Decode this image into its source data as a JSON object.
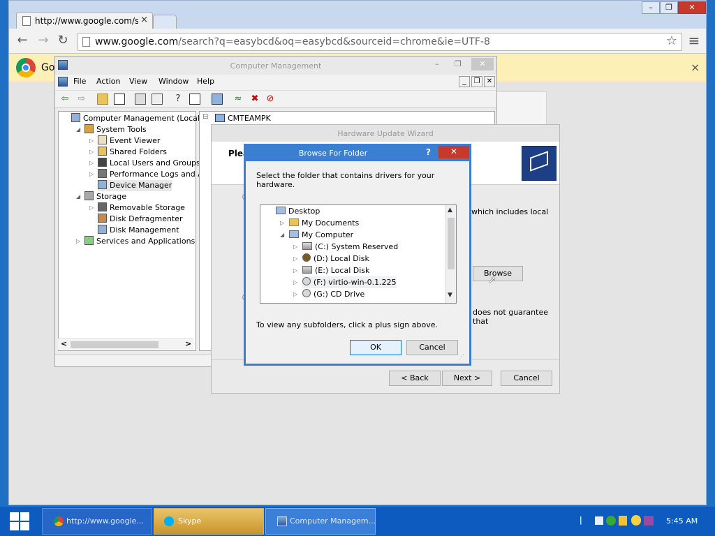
{
  "chrome": {
    "tab_title": "http://www.google.com/sear",
    "tab_close": "×",
    "url_domain": "www.google.com",
    "url_path": "/search?q=easybcd&oq=easybcd&sourceid=chrome&ie=UTF-8",
    "infobar_text": "Go",
    "window_minimize": "–",
    "window_restore": "❐",
    "window_close": "✕",
    "back": "←",
    "forward": "→",
    "reload": "↻",
    "star": "☆",
    "menu": "≡",
    "infobar_close": "×"
  },
  "computer_management": {
    "title": "Computer Management",
    "title_min": "–",
    "title_restore": "❐",
    "title_close": "✕",
    "inner_min": "_",
    "inner_restore": "❐",
    "inner_close": "✕",
    "menu": [
      "File",
      "Action",
      "View",
      "Window",
      "Help"
    ],
    "tree": [
      {
        "label": "Computer Management (Local)",
        "level": 0,
        "expander": ""
      },
      {
        "label": "System Tools",
        "level": 1,
        "expander": "◢"
      },
      {
        "label": "Event Viewer",
        "level": 2,
        "expander": "▷"
      },
      {
        "label": "Shared Folders",
        "level": 2,
        "expander": "▷"
      },
      {
        "label": "Local Users and Groups",
        "level": 2,
        "expander": "▷"
      },
      {
        "label": "Performance Logs and Alert",
        "level": 2,
        "expander": "▷"
      },
      {
        "label": "Device Manager",
        "level": 2,
        "expander": ""
      },
      {
        "label": "Storage",
        "level": 1,
        "expander": "◢"
      },
      {
        "label": "Removable Storage",
        "level": 2,
        "expander": "▷"
      },
      {
        "label": "Disk Defragmenter",
        "level": 2,
        "expander": ""
      },
      {
        "label": "Disk Management",
        "level": 2,
        "expander": ""
      },
      {
        "label": "Services and Applications",
        "level": 1,
        "expander": "▷"
      }
    ],
    "right_root": "CMTEAMPK",
    "right_expander": "⊟",
    "scroll_left": "<",
    "scroll_right": ">"
  },
  "wizard": {
    "title": "Hardware Update Wizard",
    "heading_partial": "Plea",
    "text_fragment_1": "which includes local",
    "text_fragment_2": "does not guarantee that",
    "browse_label": "Browse",
    "back_label": "< Back",
    "next_label": "Next >",
    "cancel_label": "Cancel"
  },
  "browse_dialog": {
    "title": "Browse For Folder",
    "help": "?",
    "close": "✕",
    "instruction": "Select the folder that contains drivers for your hardware.",
    "hint": "To view any subfolders, click a plus sign above.",
    "ok_label": "OK",
    "cancel_label": "Cancel",
    "scroll_up": "▲",
    "scroll_down": "▼",
    "tree": [
      {
        "label": "Desktop",
        "level": 0,
        "expander": ""
      },
      {
        "label": "My Documents",
        "level": 1,
        "expander": "▷"
      },
      {
        "label": "My Computer",
        "level": 1,
        "expander": "◢"
      },
      {
        "label": "(C:) System Reserved",
        "level": 2,
        "expander": "▷"
      },
      {
        "label": "(D:) Local Disk",
        "level": 2,
        "expander": "▷"
      },
      {
        "label": "(E:) Local Disk",
        "level": 2,
        "expander": "▷"
      },
      {
        "label": "(F:) virtio-win-0.1.225",
        "level": 2,
        "expander": "▷"
      },
      {
        "label": "(G:) CD Drive",
        "level": 2,
        "expander": "▷"
      }
    ]
  },
  "taskbar": {
    "items": [
      {
        "label": "http://www.google...",
        "icon": "chrome-icon"
      },
      {
        "label": "Skype",
        "icon": "skype-icon"
      },
      {
        "label": "Computer Managem...",
        "icon": "computer-management-icon"
      }
    ],
    "clock": "5:45 AM"
  },
  "colors": {
    "desktop": "#1f6fc4",
    "dialog_accent": "#3a7fd0",
    "close_red": "#c7392a",
    "infobar": "#fdf0b7"
  }
}
